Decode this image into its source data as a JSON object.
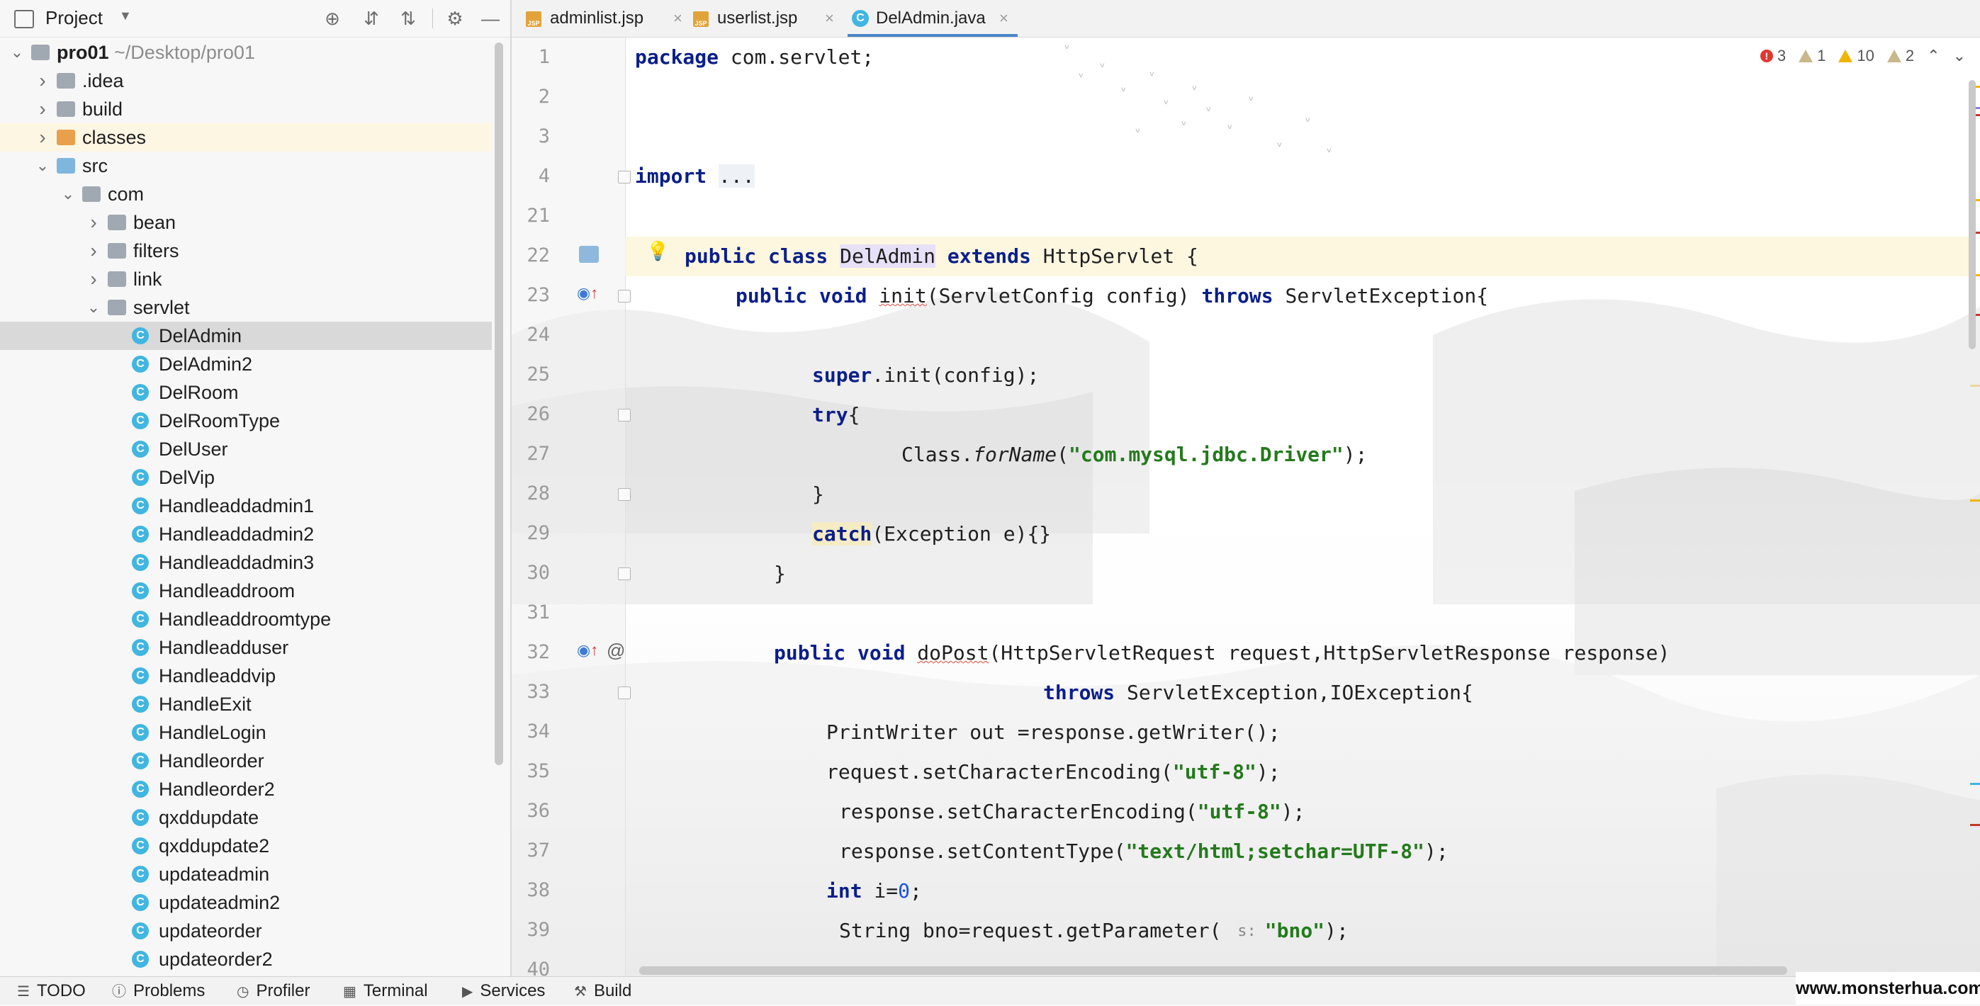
{
  "project": {
    "title": "Project",
    "tree": [
      {
        "label": "pro01",
        "path": "~/Desktop/pro01",
        "type": "module",
        "depth": 0,
        "expanded": true
      },
      {
        "label": ".idea",
        "type": "folder",
        "depth": 1,
        "expanded": false
      },
      {
        "label": "build",
        "type": "folder",
        "depth": 1,
        "expanded": false
      },
      {
        "label": "classes",
        "type": "folder-orange",
        "depth": 1,
        "expanded": false,
        "highlight": true
      },
      {
        "label": "src",
        "type": "folder-blue",
        "depth": 1,
        "expanded": true
      },
      {
        "label": "com",
        "type": "package",
        "depth": 2,
        "expanded": true
      },
      {
        "label": "bean",
        "type": "package",
        "depth": 3,
        "expanded": false
      },
      {
        "label": "filters",
        "type": "package",
        "depth": 3,
        "expanded": false
      },
      {
        "label": "link",
        "type": "package",
        "depth": 3,
        "expanded": false
      },
      {
        "label": "servlet",
        "type": "package",
        "depth": 3,
        "expanded": true
      },
      {
        "label": "DelAdmin",
        "type": "class",
        "depth": 4,
        "selected": true
      },
      {
        "label": "DelAdmin2",
        "type": "class",
        "depth": 4
      },
      {
        "label": "DelRoom",
        "type": "class",
        "depth": 4
      },
      {
        "label": "DelRoomType",
        "type": "class",
        "depth": 4
      },
      {
        "label": "DelUser",
        "type": "class",
        "depth": 4
      },
      {
        "label": "DelVip",
        "type": "class",
        "depth": 4
      },
      {
        "label": "Handleaddadmin1",
        "type": "class",
        "depth": 4
      },
      {
        "label": "Handleaddadmin2",
        "type": "class",
        "depth": 4
      },
      {
        "label": "Handleaddadmin3",
        "type": "class",
        "depth": 4
      },
      {
        "label": "Handleaddroom",
        "type": "class",
        "depth": 4
      },
      {
        "label": "Handleaddroomtype",
        "type": "class",
        "depth": 4
      },
      {
        "label": "Handleadduser",
        "type": "class",
        "depth": 4
      },
      {
        "label": "Handleaddvip",
        "type": "class",
        "depth": 4
      },
      {
        "label": "HandleExit",
        "type": "class",
        "depth": 4
      },
      {
        "label": "HandleLogin",
        "type": "class",
        "depth": 4
      },
      {
        "label": "Handleorder",
        "type": "class",
        "depth": 4
      },
      {
        "label": "Handleorder2",
        "type": "class",
        "depth": 4
      },
      {
        "label": "qxddupdate",
        "type": "class",
        "depth": 4
      },
      {
        "label": "qxddupdate2",
        "type": "class",
        "depth": 4
      },
      {
        "label": "updateadmin",
        "type": "class",
        "depth": 4
      },
      {
        "label": "updateadmin2",
        "type": "class",
        "depth": 4
      },
      {
        "label": "updateorder",
        "type": "class",
        "depth": 4
      },
      {
        "label": "updateorder2",
        "type": "class",
        "depth": 4
      }
    ]
  },
  "tabs": [
    {
      "label": "adminlist.jsp",
      "kind": "jsp",
      "active": false
    },
    {
      "label": "userlist.jsp",
      "kind": "jsp",
      "active": false
    },
    {
      "label": "DelAdmin.java",
      "kind": "class",
      "active": true
    }
  ],
  "tab_badge": "JSP",
  "class_glyph": "C",
  "inspections": {
    "errors": "3",
    "weak1": "1",
    "warnings": "10",
    "weak2": "2"
  },
  "editor": {
    "line_numbers": [
      "1",
      "2",
      "3",
      "4",
      "21",
      "22",
      "23",
      "24",
      "25",
      "26",
      "27",
      "28",
      "29",
      "30",
      "31",
      "32",
      "33",
      "34",
      "35",
      "36",
      "37",
      "38",
      "39",
      "40"
    ],
    "hint_s": "s:"
  },
  "bottom_bar": [
    {
      "label": "TODO",
      "icon": "list-icon"
    },
    {
      "label": "Problems",
      "icon": "problems-icon"
    },
    {
      "label": "Profiler",
      "icon": "profiler-icon"
    },
    {
      "label": "Terminal",
      "icon": "terminal-icon"
    },
    {
      "label": "Services",
      "icon": "services-icon"
    },
    {
      "label": "Build",
      "icon": "build-icon"
    }
  ],
  "watermark": "www.monsterhua.com",
  "colors": {
    "accent": "#4a86c7",
    "class_icon": "#40b6e0",
    "keyword": "#0b1f8a",
    "string": "#247a1c",
    "error": "#e0382f",
    "warning": "#f0b400"
  }
}
